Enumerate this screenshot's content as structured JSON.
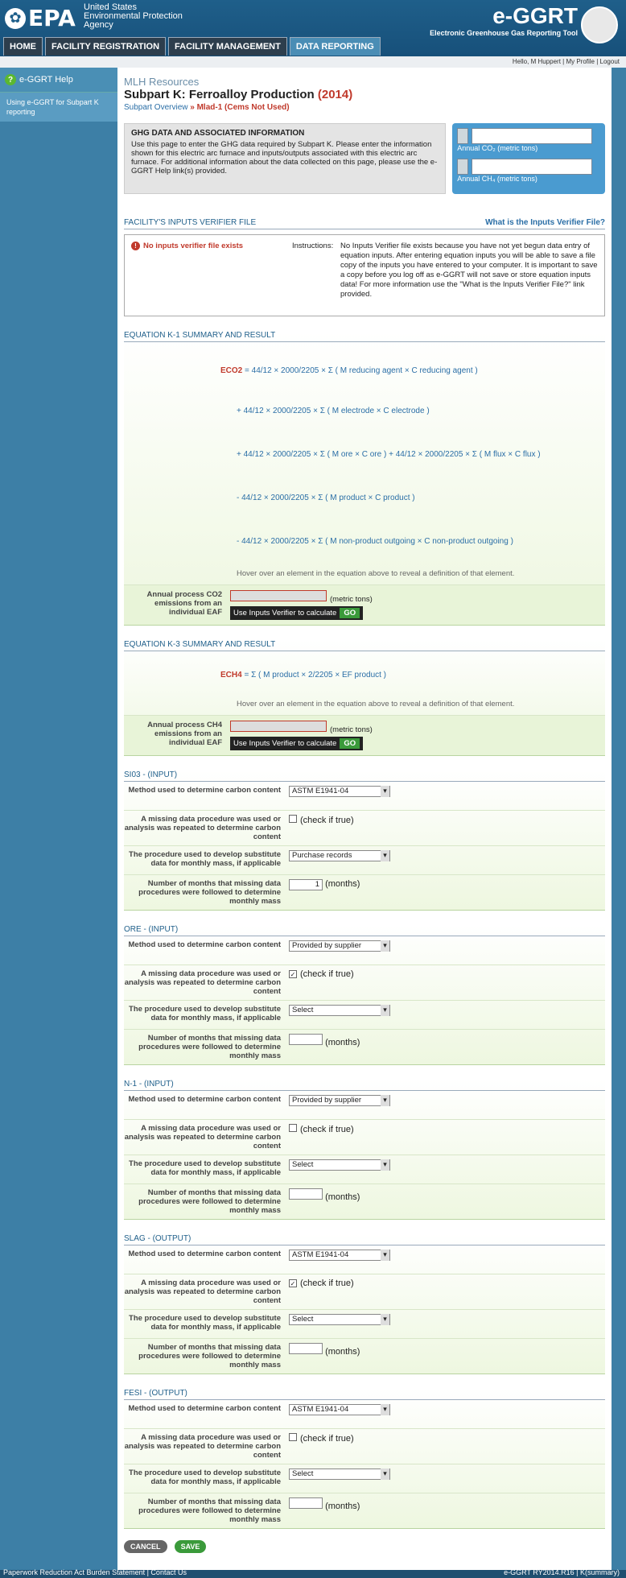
{
  "header": {
    "logo": "EPA",
    "agency": "United States Environmental Protection Agency",
    "app_name": "e-GGRT",
    "app_subtitle": "Electronic Greenhouse Gas Reporting Tool"
  },
  "nav": [
    "HOME",
    "FACILITY REGISTRATION",
    "FACILITY MANAGEMENT",
    "DATA REPORTING"
  ],
  "userbar": "Hello, M Huppert  |  My Profile  |  Logout",
  "sidebar": {
    "help": "e-GGRT Help",
    "link": "Using e-GGRT for Subpart K reporting"
  },
  "page": {
    "company": "MLH Resources",
    "title": "Subpart K: Ferroalloy Production",
    "year": "(2014)",
    "crumb_link": "Subpart Overview",
    "crumb_current": "» Mlad-1 (Cems Not Used)"
  },
  "ghg": {
    "heading": "GHG DATA AND ASSOCIATED INFORMATION",
    "text": "Use this page to enter the GHG data required by Subpart K. Please enter the information shown for this electric arc furnace and inputs/outputs associated with this electric arc furnace. For additional information about the data collected on this page, please use the e-GGRT Help link(s) provided.",
    "co2_label": "Annual CO₂ (metric tons)",
    "ch4_label": "Annual CH₄ (metric tons)"
  },
  "verifier": {
    "heading": "FACILITY'S INPUTS VERIFIER FILE",
    "link": "What is the Inputs Verifier File?",
    "error": "No inputs verifier file exists",
    "instr_label": "Instructions:",
    "instr_text": "No Inputs Verifier file exists because you have not yet begun data entry of equation inputs. After entering equation inputs you will be able to save a file copy of the inputs you have entered to your computer. It is important to save a copy before you log off as e-GGRT will not save or store equation inputs data! For more information use the \"What is the Inputs Verifier File?\" link provided."
  },
  "k1": {
    "heading": "EQUATION K-1 SUMMARY AND RESULT",
    "l1": "= 44/12 × 2000/2205 × Σ ( M reducing agent × C reducing agent )",
    "l2": "+ 44/12 × 2000/2205 × Σ ( M electrode × C electrode )",
    "l3": "+ 44/12 × 2000/2205 × Σ ( M ore × C ore ) + 44/12 × 2000/2205 × Σ ( M flux × C flux )",
    "l4": "- 44/12 × 2000/2205 × Σ ( M product × C product )",
    "l5": "- 44/12 × 2000/2205 × Σ ( M non-product outgoing × C non-product outgoing )",
    "e": "ECO2",
    "hover": "Hover over an element in the equation above to reveal a definition of that element.",
    "calc_label": "Annual process CO2 emissions from an individual EAF",
    "unit": "(metric tons)",
    "verify": "Use Inputs Verifier to calculate",
    "go": "GO"
  },
  "k3": {
    "heading": "EQUATION K-3 SUMMARY AND RESULT",
    "e": "ECH4",
    "l1": "= Σ ( M product × 2/2205 × EF product )",
    "hover": "Hover over an element in the equation above to reveal a definition of that element.",
    "calc_label": "Annual process CH4 emissions from an individual EAF",
    "unit": "(metric tons)",
    "verify": "Use Inputs Verifier to calculate",
    "go": "GO"
  },
  "labels": {
    "method": "Method used to determine carbon content",
    "missing": "A missing data procedure was used or analysis was repeated to determine carbon content",
    "check": "(check if true)",
    "procedure": "The procedure used to develop substitute data for monthly mass, if applicable",
    "months": "Number of months that missing data procedures were followed to determine monthly mass",
    "months_unit": "(months)"
  },
  "sections": [
    {
      "heading": "SI03 - (INPUT)",
      "method": "ASTM E1941-04",
      "checked": "",
      "procedure": "Purchase records",
      "months": "1"
    },
    {
      "heading": "ORE - (INPUT)",
      "method": "Provided by supplier",
      "checked": "✓",
      "procedure": "Select",
      "months": ""
    },
    {
      "heading": "N-1 - (INPUT)",
      "method": "Provided by supplier",
      "checked": "",
      "procedure": "Select",
      "months": ""
    },
    {
      "heading": "SLAG - (OUTPUT)",
      "method": "ASTM E1941-04",
      "checked": "✓",
      "procedure": "Select",
      "months": ""
    },
    {
      "heading": "FESI - (OUTPUT)",
      "method": "ASTM E1941-04",
      "checked": "",
      "procedure": "Select",
      "months": ""
    }
  ],
  "buttons": {
    "cancel": "CANCEL",
    "save": "SAVE"
  },
  "footer": {
    "left": "Paperwork Reduction Act Burden Statement  |  Contact Us",
    "right": "e-GGRT RY2014.R16  |  K(summary)"
  }
}
